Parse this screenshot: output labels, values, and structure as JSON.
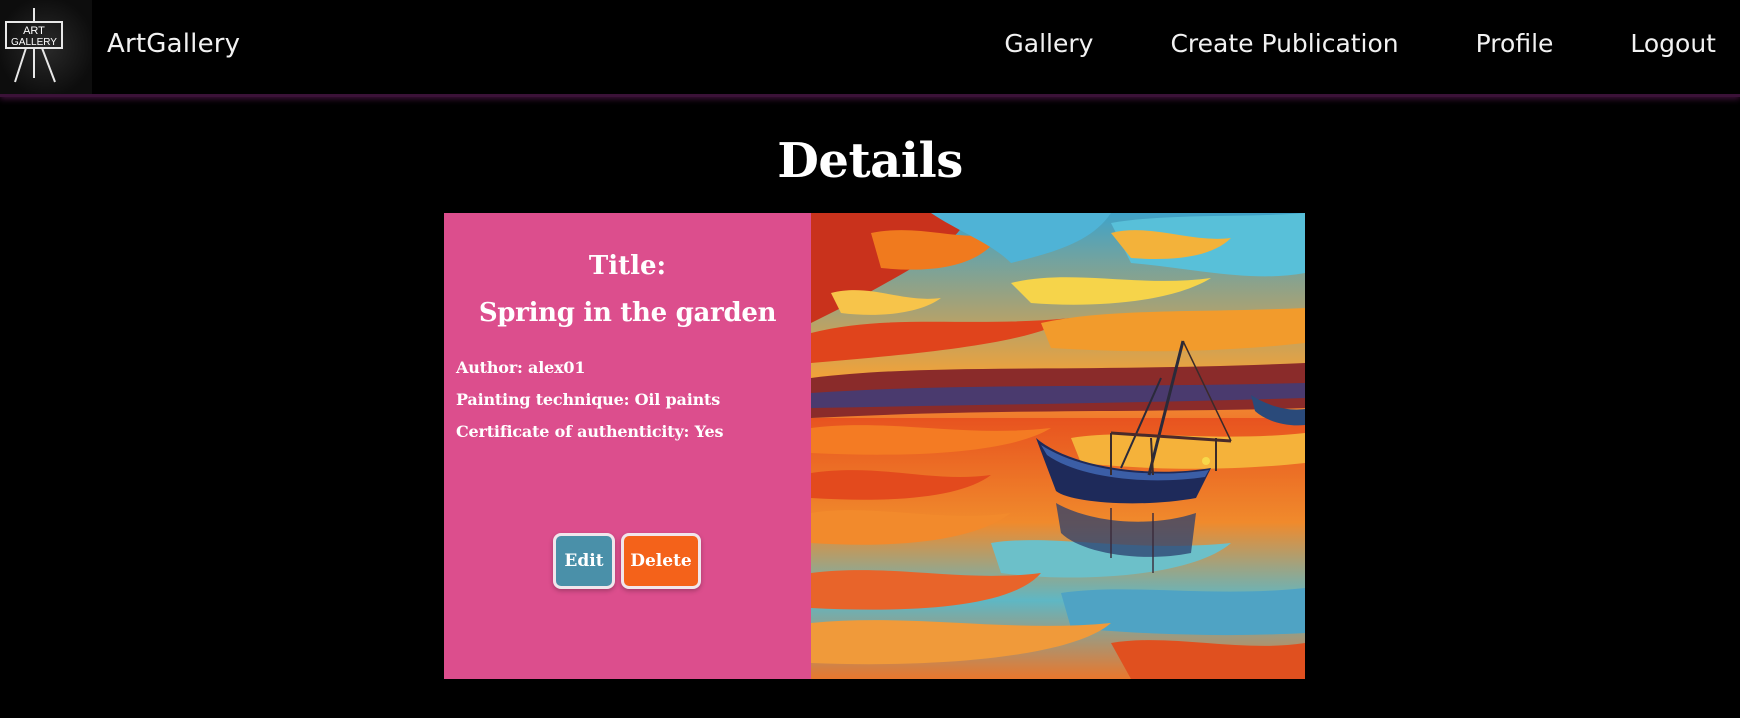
{
  "header": {
    "logo_text_line1": "ART",
    "logo_text_line2": "GALLERY",
    "brand": "ArtGallery",
    "nav": [
      "Gallery",
      "Create Publication",
      "Profile",
      "Logout"
    ]
  },
  "page": {
    "title": "Details"
  },
  "details": {
    "title_label": "Title:",
    "title_value": "Spring in the garden",
    "author": "Author: alex01",
    "technique": "Painting technique: Oil paints",
    "certificate": "Certificate of authenticity: Yes",
    "edit_label": "Edit",
    "delete_label": "Delete"
  },
  "colors": {
    "background": "#000000",
    "info_panel": "#dc4e8d",
    "edit_button": "#4a90a9",
    "delete_button": "#f4621a"
  }
}
